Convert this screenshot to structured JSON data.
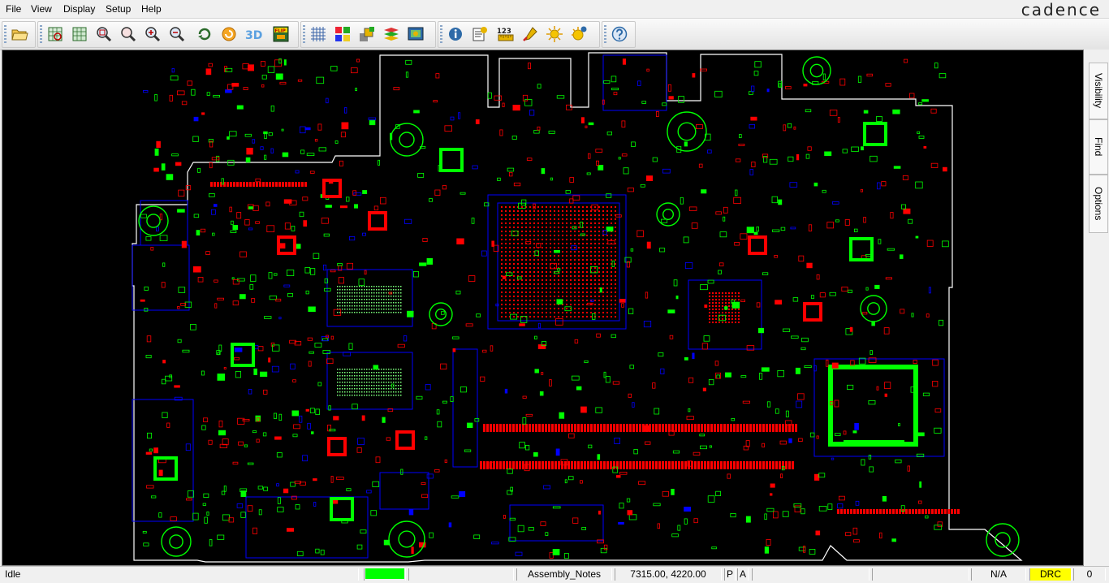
{
  "menu": {
    "file": "File",
    "view": "View",
    "display": "Display",
    "setup": "Setup",
    "help": "Help"
  },
  "brand": {
    "logo": "cadence"
  },
  "toolbar": {
    "flip_label": "FLIP",
    "three_d_label": "3D",
    "count_label": "123",
    "icons": [
      "open-folder-icon",
      "zoom-fit-icon",
      "zoom-world-icon",
      "zoom-select-icon",
      "zoom-previous-icon",
      "zoom-in-icon",
      "zoom-out-icon",
      "refresh-icon",
      "redraw-icon",
      "3d-view-icon",
      "flip-icon",
      "grid-icon",
      "color-dialog-icon",
      "layer-icon",
      "stackup-icon",
      "board-view-icon",
      "info-icon",
      "properties-icon",
      "measure-icon",
      "highlight-icon",
      "brightness-icon",
      "dehighlight-icon",
      "help-icon"
    ]
  },
  "side_tabs": {
    "visibility": "Visibility",
    "find": "Find",
    "options": "Options"
  },
  "status": {
    "state": "Idle",
    "indicator_color": "#00ff00",
    "layer": "Assembly_Notes",
    "coordinates": "7315.00, 4220.00",
    "p_label": "P",
    "a_label": "A",
    "mode": "N/A",
    "drc_label": "DRC",
    "drc_color": "#ffff00",
    "drc_count": "0"
  },
  "colors": {
    "canvas_bg": "#000000",
    "outline": "#ffffff",
    "copper_red": "#ff0000",
    "copper_green": "#00ff00",
    "routing_blue": "#0000ff"
  }
}
